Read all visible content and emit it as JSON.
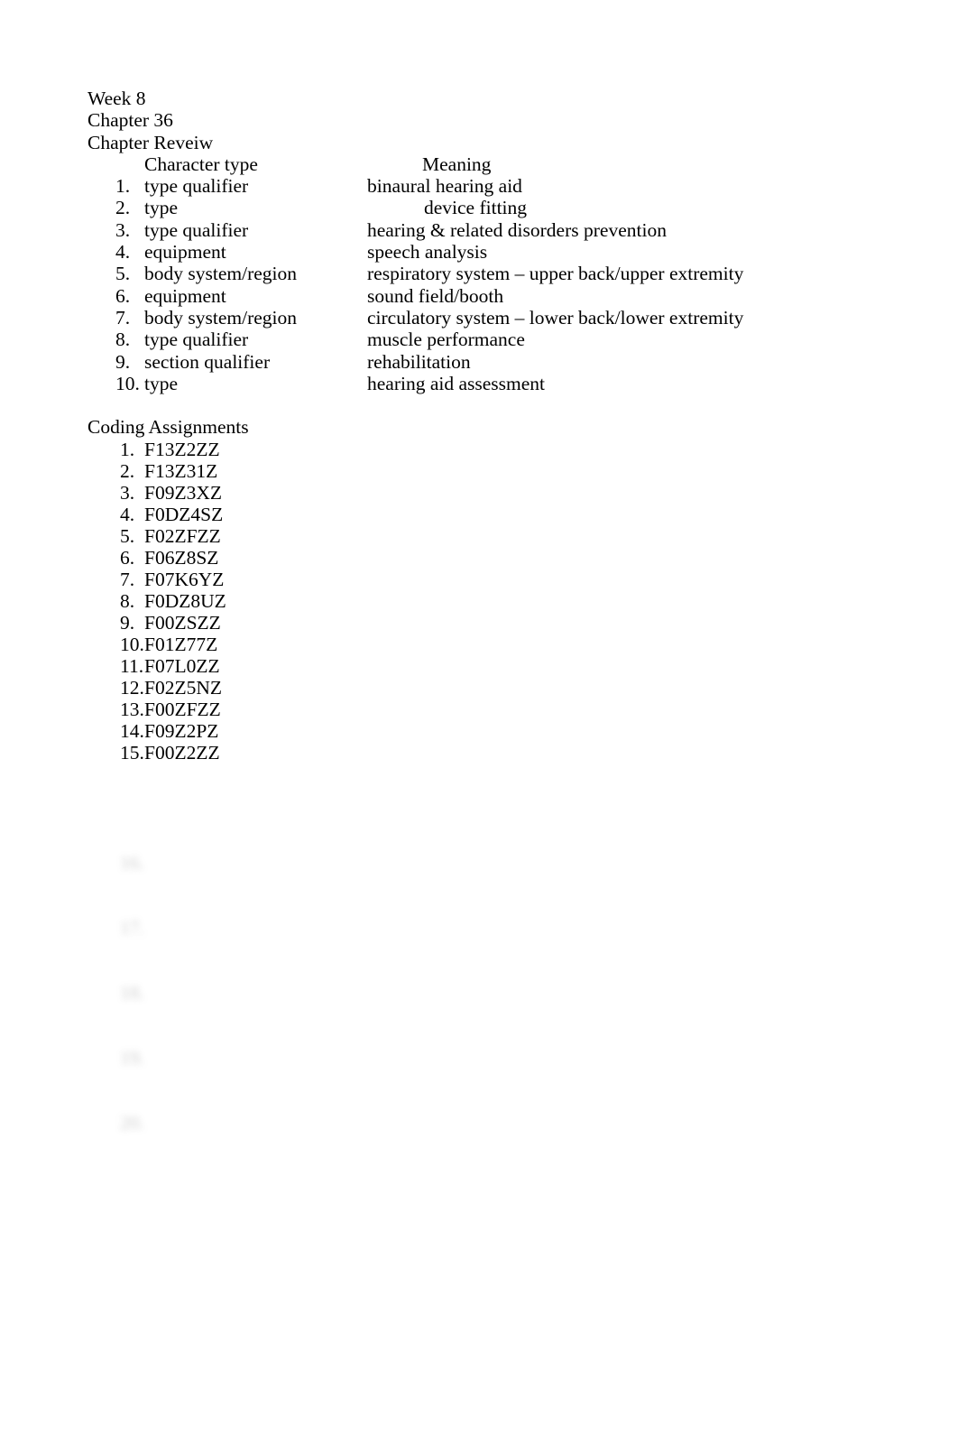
{
  "document": {
    "header_lines": [
      "Week 8",
      "Chapter 36",
      "Chapter Reveiw"
    ],
    "review_table": {
      "col_character_type": "Character type",
      "col_meaning": "Meaning",
      "rows": [
        {
          "num": "1.",
          "character_type": "type qualifier",
          "meaning": "binaural hearing aid"
        },
        {
          "num": "2.",
          "character_type": "type",
          "meaning": "device fitting"
        },
        {
          "num": "3.",
          "character_type": "type qualifier",
          "meaning": "hearing & related disorders prevention"
        },
        {
          "num": "4.",
          "character_type": "equipment",
          "meaning": "speech analysis"
        },
        {
          "num": "5.",
          "character_type": "body system/region",
          "meaning": "respiratory system – upper back/upper extremity"
        },
        {
          "num": "6.",
          "character_type": "equipment",
          "meaning": "sound field/booth"
        },
        {
          "num": "7.",
          "character_type": "body system/region",
          "meaning": "circulatory system – lower back/lower extremity"
        },
        {
          "num": "8.",
          "character_type": "type qualifier",
          "meaning": "muscle performance"
        },
        {
          "num": "9.",
          "character_type": "section qualifier",
          "meaning": "rehabilitation"
        },
        {
          "num": "10.",
          "character_type": "type",
          "meaning": "hearing aid assessment"
        }
      ]
    },
    "coding_assignments": {
      "title": "Coding Assignments",
      "items": [
        {
          "num": "1.",
          "code": "F13Z2ZZ"
        },
        {
          "num": "2.",
          "code": "F13Z31Z"
        },
        {
          "num": "3.",
          "code": "F09Z3XZ"
        },
        {
          "num": "4.",
          "code": "F0DZ4SZ"
        },
        {
          "num": "5.",
          "code": "F02ZFZZ"
        },
        {
          "num": "6.",
          "code": "F06Z8SZ"
        },
        {
          "num": "7.",
          "code": "F07K6YZ"
        },
        {
          "num": "8.",
          "code": "F0DZ8UZ"
        },
        {
          "num": "9.",
          "code": "F00ZSZZ"
        },
        {
          "num": "10.",
          "code": "F01Z77Z"
        },
        {
          "num": "11.",
          "code": "F07L0ZZ"
        },
        {
          "num": "12.",
          "code": "F02Z5NZ"
        },
        {
          "num": "13.",
          "code": "F00ZFZZ"
        },
        {
          "num": "14.",
          "code": "F09Z2PZ"
        },
        {
          "num": "15.",
          "code": "F00Z2ZZ"
        }
      ]
    },
    "obscured": {
      "note": "trailing content is blurred and illegible in the screenshot",
      "block_1": [
        {
          "num": "16.",
          "code": ""
        },
        {
          "num": "17.",
          "code": ""
        },
        {
          "num": "18.",
          "code": ""
        },
        {
          "num": "19.",
          "code": ""
        },
        {
          "num": "20.",
          "code": ""
        }
      ],
      "block_2": [
        "",
        "",
        "",
        "",
        "",
        ""
      ],
      "block_3": [
        "",
        "",
        "",
        "",
        "",
        ""
      ]
    }
  }
}
